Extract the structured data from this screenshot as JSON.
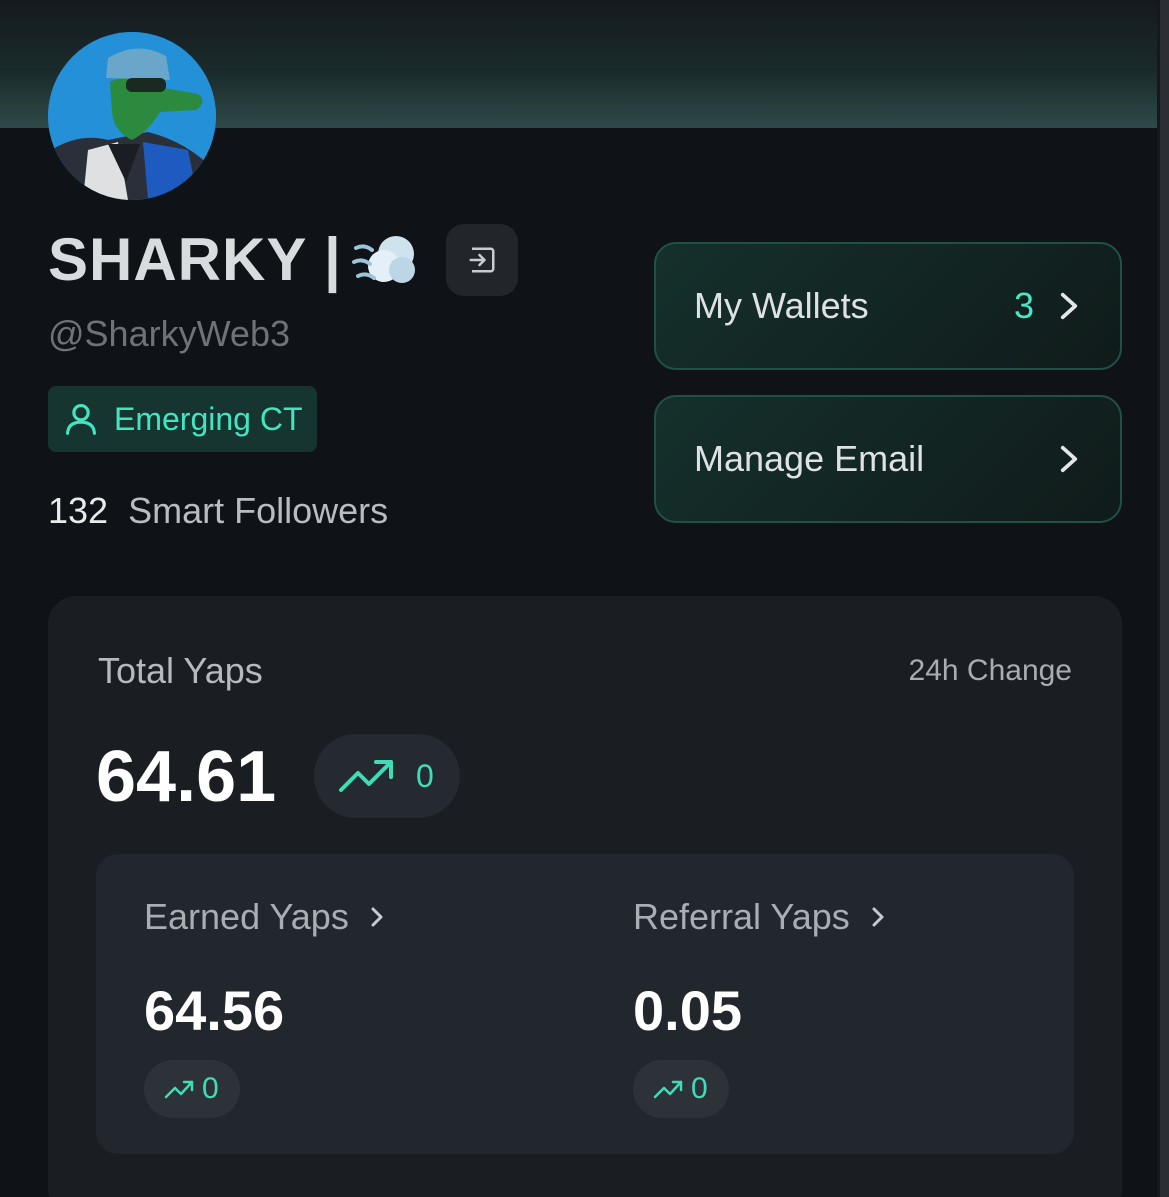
{
  "profile": {
    "display_name": "SHARKY |",
    "handle": "@SharkyWeb3",
    "emoji_icon": "dashing-away-emoji",
    "tier_badge": "Emerging CT",
    "smart_followers_count": "132",
    "smart_followers_label": "Smart Followers"
  },
  "side_actions": {
    "wallets_label": "My Wallets",
    "wallets_count": "3",
    "email_label": "Manage Email"
  },
  "yaps": {
    "title": "Total Yaps",
    "change_label": "24h Change",
    "total": "64.61",
    "total_change": "0",
    "earned_label": "Earned Yaps",
    "earned_value": "64.56",
    "earned_change": "0",
    "referral_label": "Referral Yaps",
    "referral_value": "0.05",
    "referral_change": "0"
  },
  "colors": {
    "accent": "#42e5c0",
    "background": "#0f1216",
    "card": "#1a1e23"
  }
}
